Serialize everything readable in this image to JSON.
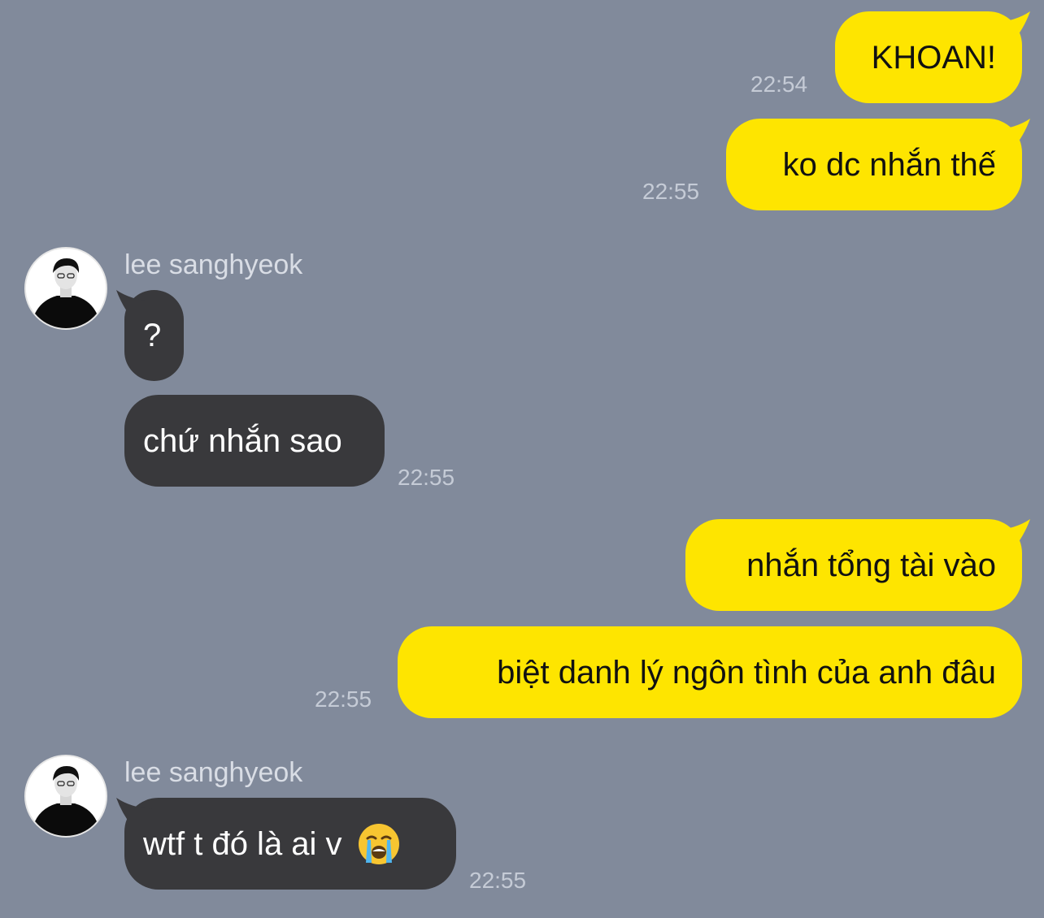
{
  "colors": {
    "background": "#818a9b",
    "sent_bubble": "#fee500",
    "received_bubble": "#39393c"
  },
  "contact": {
    "name": "lee sanghyeok",
    "avatar_icon": "profile-photo-icon"
  },
  "messages": [
    {
      "direction": "sent",
      "text": "KHOAN!",
      "time": "22:54"
    },
    {
      "direction": "sent",
      "text": "ko dc nhắn thế",
      "time": "22:55"
    },
    {
      "direction": "received",
      "sender": "lee sanghyeok",
      "text": "?"
    },
    {
      "direction": "received",
      "text": "chứ nhắn sao",
      "time": "22:55"
    },
    {
      "direction": "sent",
      "text": "nhắn tổng tài vào"
    },
    {
      "direction": "sent",
      "text": "biệt danh lý ngôn tình của anh đâu",
      "time": "22:55"
    },
    {
      "direction": "received",
      "sender": "lee sanghyeok",
      "text": "wtf t đó là ai v",
      "emoji": "loudly-crying-face-icon",
      "time": "22:55"
    }
  ]
}
